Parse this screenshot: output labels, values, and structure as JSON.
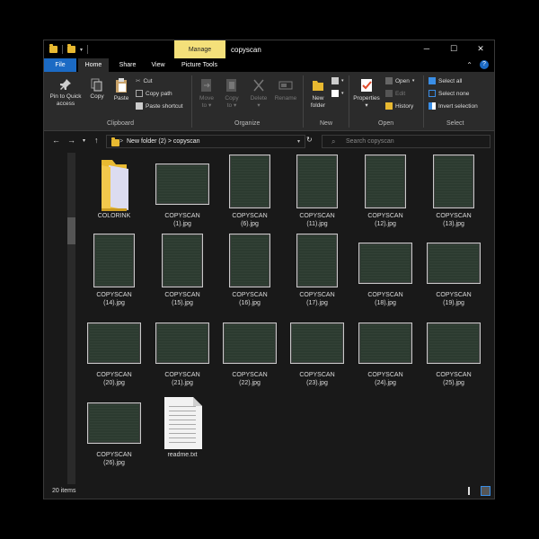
{
  "window": {
    "title": "copyscan",
    "manage_tab": "Manage",
    "controls": {
      "minimize": "─",
      "maximize": "☐",
      "close": "✕"
    }
  },
  "ribbon_tabs": [
    "File",
    "Home",
    "Share",
    "View",
    "Picture Tools"
  ],
  "ribbon": {
    "clipboard": {
      "title": "Clipboard",
      "pin_line1": "Pin to Quick",
      "pin_line2": "access",
      "copy": "Copy",
      "paste": "Paste",
      "cut": "Cut",
      "copy_path": "Copy path",
      "paste_shortcut": "Paste shortcut"
    },
    "organize": {
      "title": "Organize",
      "move_to_1": "Move",
      "move_to_2": "to ▾",
      "copy_to_1": "Copy",
      "copy_to_2": "to ▾",
      "delete_1": "Delete",
      "delete_2": "▾",
      "rename": "Rename"
    },
    "new": {
      "title": "New",
      "new_folder_1": "New",
      "new_folder_2": "folder"
    },
    "open": {
      "title": "Open",
      "properties_1": "Properties",
      "properties_2": "▾",
      "open": "Open",
      "edit": "Edit",
      "history": "History"
    },
    "select": {
      "title": "Select",
      "select_all": "Select all",
      "select_none": "Select none",
      "invert": "Invert selection"
    }
  },
  "address": {
    "path": "New folder (2)  >  copyscan",
    "breadcrumb_sep": ">"
  },
  "search": {
    "placeholder": "Search copyscan"
  },
  "files": [
    {
      "line1": "COLORINK",
      "line2": "",
      "kind": "folder"
    },
    {
      "line1": "COPYSCAN",
      "line2": "(1).jpg",
      "kind": "landscape"
    },
    {
      "line1": "COPYSCAN",
      "line2": "(6).jpg",
      "kind": "portrait"
    },
    {
      "line1": "COPYSCAN",
      "line2": "(11).jpg",
      "kind": "portrait"
    },
    {
      "line1": "COPYSCAN",
      "line2": "(12).jpg",
      "kind": "portrait"
    },
    {
      "line1": "COPYSCAN",
      "line2": "(13).jpg",
      "kind": "portrait"
    },
    {
      "line1": "COPYSCAN",
      "line2": "(14).jpg",
      "kind": "portrait"
    },
    {
      "line1": "COPYSCAN",
      "line2": "(15).jpg",
      "kind": "portrait"
    },
    {
      "line1": "COPYSCAN",
      "line2": "(16).jpg",
      "kind": "portrait"
    },
    {
      "line1": "COPYSCAN",
      "line2": "(17).jpg",
      "kind": "portrait"
    },
    {
      "line1": "COPYSCAN",
      "line2": "(18).jpg",
      "kind": "landscape"
    },
    {
      "line1": "COPYSCAN",
      "line2": "(19).jpg",
      "kind": "landscape"
    },
    {
      "line1": "COPYSCAN",
      "line2": "(20).jpg",
      "kind": "landscape"
    },
    {
      "line1": "COPYSCAN",
      "line2": "(21).jpg",
      "kind": "landscape"
    },
    {
      "line1": "COPYSCAN",
      "line2": "(22).jpg",
      "kind": "landscape"
    },
    {
      "line1": "COPYSCAN",
      "line2": "(23).jpg",
      "kind": "landscape"
    },
    {
      "line1": "COPYSCAN",
      "line2": "(24).jpg",
      "kind": "landscape"
    },
    {
      "line1": "COPYSCAN",
      "line2": "(25).jpg",
      "kind": "landscape"
    },
    {
      "line1": "COPYSCAN",
      "line2": "(26).jpg",
      "kind": "landscape"
    },
    {
      "line1": "readme.txt",
      "line2": "",
      "kind": "text"
    }
  ],
  "status": {
    "count": "20 items"
  },
  "colors": {
    "accent": "#1b6ac4",
    "manage": "#f4e07a",
    "folder": "#e8b931",
    "background": "#191919"
  }
}
